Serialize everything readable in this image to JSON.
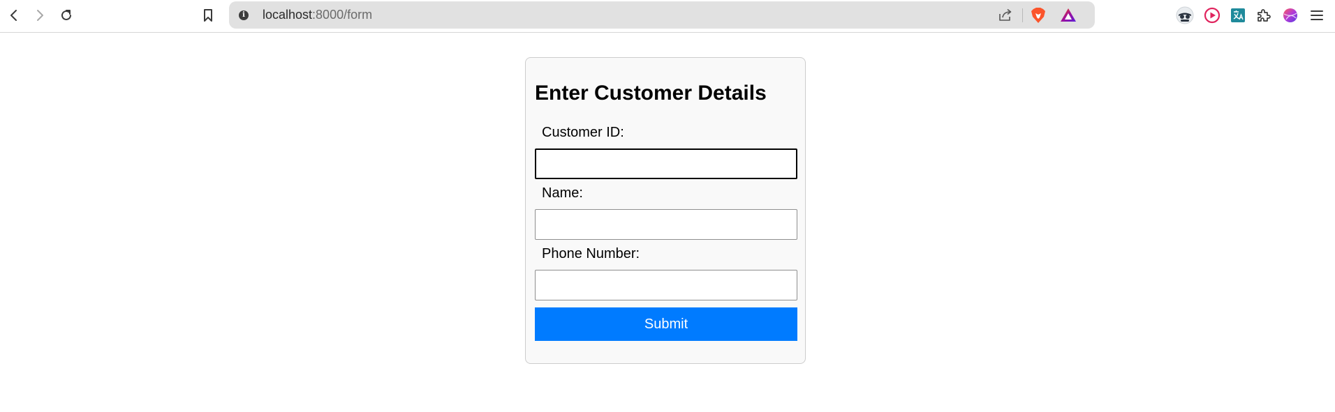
{
  "browser": {
    "url_host": "localhost",
    "url_path": ":8000/form",
    "icons": {
      "back": "back-arrow-icon",
      "forward": "forward-arrow-icon",
      "reload": "reload-icon",
      "bookmark": "bookmark-icon",
      "site_info": "info-icon",
      "share": "share-icon",
      "brave_shields": "brave-lion-icon",
      "brave_rewards": "brave-rewards-triangle-icon"
    },
    "extensions": [
      "spy-mask-extension-icon",
      "play-circle-extension-icon",
      "translate-extension-icon",
      "puzzle-extensions-icon",
      "profile-globe-icon",
      "hamburger-menu-icon"
    ],
    "info_glyph": "i"
  },
  "form": {
    "title": "Enter Customer Details",
    "fields": [
      {
        "label": "Customer ID:",
        "value": "",
        "focused": true
      },
      {
        "label": "Name:",
        "value": ""
      },
      {
        "label": "Phone Number:",
        "value": ""
      }
    ],
    "submit_label": "Submit"
  },
  "colors": {
    "submit_bg": "#007bff",
    "card_bg": "#f9f9f9",
    "urlbar_bg": "#e1e1e1",
    "brave_orange": "#fb542b"
  }
}
